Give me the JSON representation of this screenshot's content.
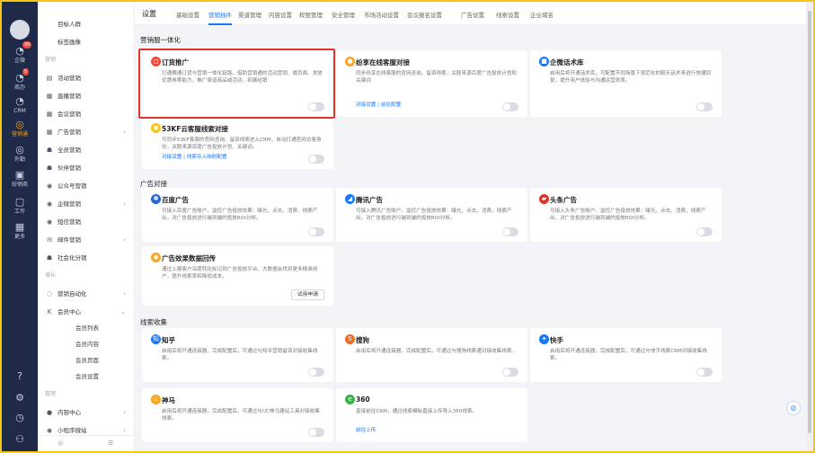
{
  "rail": {
    "items": [
      {
        "icon": "◔",
        "label": "企微",
        "badge": "99"
      },
      {
        "icon": "◔",
        "label": "商办",
        "badge": "5"
      },
      {
        "icon": "◔",
        "label": "CRM",
        "badge": ""
      },
      {
        "icon": "◎",
        "label": "营销通",
        "badge": ""
      },
      {
        "icon": "◎",
        "label": "外勤",
        "badge": ""
      },
      {
        "icon": "▣",
        "label": "纷销商",
        "badge": ""
      },
      {
        "icon": "▢",
        "label": "工作",
        "badge": ""
      },
      {
        "icon": "▦",
        "label": "更多",
        "badge": ""
      }
    ],
    "bottom": [
      "?",
      "⚙",
      "◷",
      "⚇"
    ]
  },
  "nav": {
    "items": [
      {
        "icon": "",
        "label": "目标人群",
        "chev": ""
      },
      {
        "icon": "",
        "label": "标签画像",
        "chev": ""
      },
      {
        "icon": "",
        "label": "营销",
        "chev": "",
        "grp": true
      },
      {
        "icon": "▤",
        "label": "活动营销",
        "chev": ""
      },
      {
        "icon": "▦",
        "label": "直播营销",
        "chev": ""
      },
      {
        "icon": "▦",
        "label": "会议营销",
        "chev": ""
      },
      {
        "icon": "▦",
        "label": "广告营销",
        "chev": "›"
      },
      {
        "icon": "☗",
        "label": "全员营销",
        "chev": ""
      },
      {
        "icon": "☗",
        "label": "伙伴营销",
        "chev": ""
      },
      {
        "icon": "◉",
        "label": "公众号营销",
        "chev": ""
      },
      {
        "icon": "◉",
        "label": "企微营销",
        "chev": "›"
      },
      {
        "icon": "◉",
        "label": "短信营销",
        "chev": ""
      },
      {
        "icon": "✉",
        "label": "邮件营销",
        "chev": "›"
      },
      {
        "icon": "☗",
        "label": "社会化分销",
        "chev": ""
      },
      {
        "icon": "",
        "label": "增长",
        "chev": "",
        "grp": true
      },
      {
        "icon": "◌",
        "label": "营销自动化",
        "chev": "›"
      },
      {
        "icon": "K",
        "label": "会员中心",
        "chev": "⌄"
      },
      {
        "icon": "",
        "label": "会员列表",
        "chev": "",
        "sub": true
      },
      {
        "icon": "",
        "label": "会员内容",
        "chev": "",
        "sub": true
      },
      {
        "icon": "",
        "label": "会员页面",
        "chev": "",
        "sub": true
      },
      {
        "icon": "",
        "label": "会员设置",
        "chev": "",
        "sub": true
      },
      {
        "icon": "",
        "label": "管理",
        "chev": "",
        "grp": true
      },
      {
        "icon": "●",
        "label": "内容中心",
        "chev": "›"
      },
      {
        "icon": "◉",
        "label": "小程序微站",
        "chev": "›"
      }
    ],
    "foot": [
      "◎",
      "☰"
    ]
  },
  "header": {
    "title": "设置",
    "tabs": [
      "基础设置",
      "营销插件",
      "渠道管理",
      "内容设置",
      "权限管理",
      "安全管理",
      "市场活动设置",
      "会议报名设置",
      "广告设置",
      "线索设置",
      "企业域名"
    ],
    "active": 1
  },
  "sections": {
    "s1": "营销服一体化",
    "s2": "广告对接",
    "s3": "线索收集"
  },
  "cards": {
    "c1": {
      "title": "订货推广",
      "desc": "打通赛通订货与营销一体化链路，借助营销通的活动营销、微页面、发放优惠券等能力，推广渠道商品或活动，拓展经销",
      "link": ""
    },
    "c2": {
      "title": "纷享在线客服对接",
      "desc": "同步纷享在线客服的官网咨询、留资线索，关联来源百度广告投放计划和关键词",
      "link": "对接设置 | 前往配置"
    },
    "c3": {
      "title": "企微话术库",
      "desc": "启用后将开通话术库，可配置不同场景下规范化的聊天话术来进行快捷回复，提升用户体验与沟通运营效率。",
      "link": ""
    },
    "c4": {
      "title": "53KF云客服线索对接",
      "desc": "可同步53KF客服的官网咨询、留资线索进入CRM，自动打通官网访客身份，关联来源百度广告投放计划、关键词。",
      "link": "对接设置 | 线索存入映射配置"
    },
    "c5": {
      "title": "百度广告",
      "desc": "可接入百度广告账户，监控广告投放效果：曝光、点击、消费、线索产出，对广告投放进行端到端的投放ROI分析。",
      "link": ""
    },
    "c6": {
      "title": "腾讯广告",
      "desc": "可接入腾讯广告账户，监控广告投放效果：曝光、点击、消费，线索产出，对广告投放进行端到端的投放ROI分析。",
      "link": ""
    },
    "c7": {
      "title": "头条广告",
      "desc": "可接入头条广告账户，监控广告投放效果：曝光、点击、消费，线索产出，对广告投放进行端到端的投放ROI分析。",
      "link": ""
    },
    "c8": {
      "title": "广告效果数据回传",
      "desc": "通过上报客户深度转化标记到广告投放平台，大数据会找到更多精准用户，提升线索率和降低成本。",
      "button": "试用申请"
    },
    "c9": {
      "title": "知乎",
      "desc": "启用后将开通连接器，完成配置后，可通过与知乎营销留资对接收集线索。",
      "link": ""
    },
    "c10": {
      "title": "搜狗",
      "desc": "启用后将开通连接器，完成配置后，可通过与搜狗线索通对接收集线索。",
      "link": ""
    },
    "c11": {
      "title": "快手",
      "desc": "启用后将开通连接器，完成配置后，可通过与快手线索CRM对接收集线索。",
      "link": ""
    },
    "c12": {
      "title": "神马",
      "desc": "启用后将开通连接器，完成配置后，可通过与UC神马建站工具对接收集线索。",
      "link": ""
    },
    "c13": {
      "title": "360",
      "desc": "直接前往CRM，通过线索模板直接上传导入360线索。",
      "link": "前往上传"
    }
  },
  "colors": {
    "accent": "#1677ff",
    "highlight": "#e0332b",
    "rail": "#1e2a48"
  }
}
